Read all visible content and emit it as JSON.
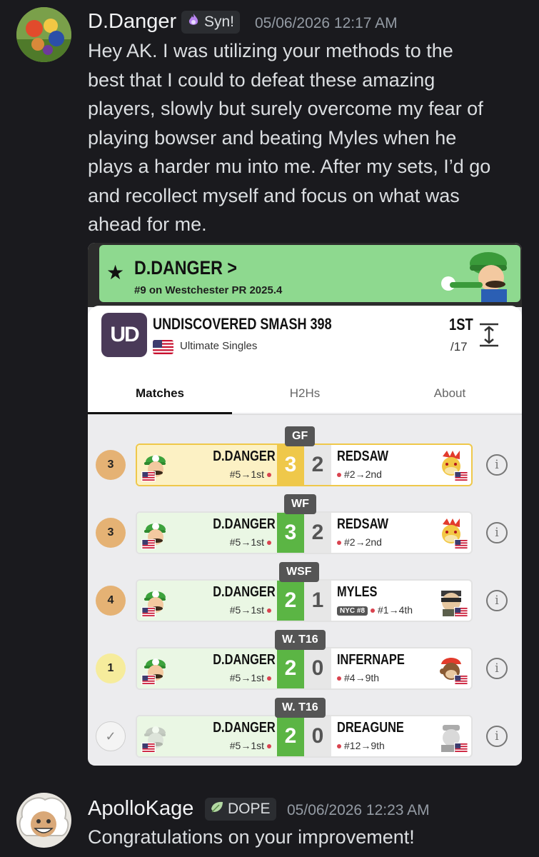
{
  "messages": [
    {
      "username": "D.Danger",
      "tag": "Syn!",
      "timestamp": "05/06/2026 12:17 AM",
      "lines": [
        "Hey AK. I was utilizing your methods to the",
        "best that I could to defeat these amazing",
        "players, slowly but surely overcome my fear of",
        "playing bowser and beating Myles when he",
        "plays a harder mu into me. After my sets, I’d go",
        "and recollect myself and focus on what was",
        "ahead for me."
      ]
    },
    {
      "username": "ApolloKage",
      "tag": "DOPE",
      "timestamp": "05/06/2026 12:23 AM",
      "lines": [
        "Congratulations on your improvement!"
      ]
    }
  ],
  "embed": {
    "banner": {
      "name": "D.DANGER",
      "chevron": ">",
      "subtitle": "#9 on Westchester PR 2025.4"
    },
    "tournament": {
      "logo_text": "UD",
      "name": "UNDISCOVERED SMASH 398",
      "event": "Ultimate Singles",
      "placement": "1ST",
      "entrants": "/17"
    },
    "tabs": [
      "Matches",
      "H2Hs",
      "About"
    ],
    "matches": [
      {
        "round_label": "GF",
        "round_num": "3",
        "player": "D.DANGER",
        "player_info": "#5→1st",
        "score_left": "3",
        "score_right": "2",
        "opponent": "REDSAW",
        "opponent_info": "#2→2nd"
      },
      {
        "round_label": "WF",
        "round_num": "3",
        "player": "D.DANGER",
        "player_info": "#5→1st",
        "score_left": "3",
        "score_right": "2",
        "opponent": "REDSAW",
        "opponent_info": "#2→2nd"
      },
      {
        "round_label": "WSF",
        "round_num": "4",
        "player": "D.DANGER",
        "player_info": "#5→1st",
        "score_left": "2",
        "score_right": "1",
        "opponent": "MYLES",
        "opponent_badge": "NYC #8",
        "opponent_info": "#1→4th"
      },
      {
        "round_label": "W. T16",
        "round_num": "1",
        "player": "D.DANGER",
        "player_info": "#5→1st",
        "score_left": "2",
        "score_right": "0",
        "opponent": "INFERNAPE",
        "opponent_info": "#4→9th"
      },
      {
        "round_label": "W. T16",
        "round_num": "✓",
        "player": "D.DANGER",
        "player_info": "#5→1st",
        "score_left": "2",
        "score_right": "0",
        "opponent": "DREAGUNE",
        "opponent_info": "#12→9th"
      }
    ]
  },
  "colors": {
    "background": "#1a1a1e",
    "winner_green": "#5bb544",
    "gf_gold": "#efc84a",
    "banner_green": "#8ed98f"
  }
}
